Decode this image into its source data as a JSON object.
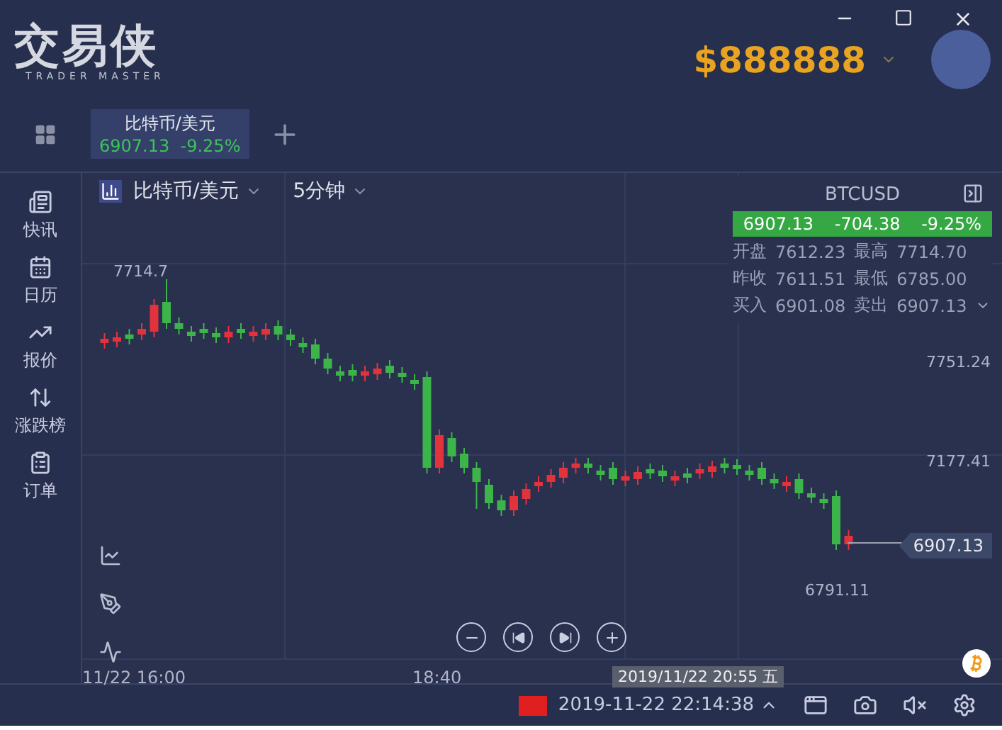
{
  "app": {
    "logo": "交易侠",
    "logo_subtitle": "TRADER MASTER",
    "balance": "$888888"
  },
  "tabs": [
    {
      "name": "比特币/美元",
      "price": "6907.13",
      "change": "-9.25%",
      "selected": true
    }
  ],
  "sidebar": {
    "items": [
      {
        "label": "快讯"
      },
      {
        "label": "日历"
      },
      {
        "label": "报价"
      },
      {
        "label": "涨跌榜"
      },
      {
        "label": "订单"
      }
    ]
  },
  "chart_header": {
    "symbol": "比特币/美元",
    "interval": "5分钟"
  },
  "quote_panel": {
    "symbol": "BTCUSD",
    "price": "6907.13",
    "change": "-704.38",
    "change_percent": "-9.25%",
    "rows": [
      {
        "label": "开盘",
        "value": "7612.23",
        "label2": "最高",
        "value2": "7714.70"
      },
      {
        "label": "昨收",
        "value": "7611.51",
        "label2": "最低",
        "value2": "6785.00"
      },
      {
        "label": "买入",
        "value": "6901.08",
        "label2": "卖出",
        "value2": "6907.13"
      }
    ]
  },
  "chart": {
    "high_label": "7714.7",
    "low_label": "6791.11",
    "price_labels": [
      "7751.24",
      "7177.41"
    ],
    "last_price": "6907.13",
    "time_labels": [
      "11/22 16:00",
      "18:40"
    ],
    "crosshair_time": "2019/11/22 20:55 五"
  },
  "status_bar": {
    "datetime": "2019-11-22 22:14:38"
  }
}
